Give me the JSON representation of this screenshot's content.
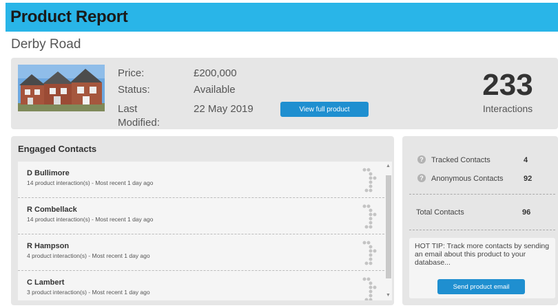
{
  "header": {
    "title": "Product Report"
  },
  "product": {
    "name": "Derby Road",
    "price_label": "Price:",
    "price": "£200,000",
    "status_label": "Status:",
    "status": "Available",
    "modified_label": "Last Modified:",
    "modified": "22 May 2019",
    "view_button": "View full product",
    "interactions": "233",
    "interactions_label": "Interactions"
  },
  "engaged": {
    "title": "Engaged Contacts",
    "contacts": [
      {
        "name": "D Bullimore",
        "meta": "14 product interaction(s) - Most recent 1 day ago"
      },
      {
        "name": "R Combellack",
        "meta": "14 product interaction(s) - Most recent 1 day ago"
      },
      {
        "name": "R Hampson",
        "meta": "4 product interaction(s) - Most recent 1 day ago"
      },
      {
        "name": "C Lambert",
        "meta": "3 product interaction(s) - Most recent 1 day ago"
      }
    ]
  },
  "stats": {
    "tracked_label": "Tracked Contacts",
    "tracked": "4",
    "anonymous_label": "Anonymous Contacts",
    "anonymous": "92",
    "total_label": "Total Contacts",
    "total": "96",
    "tip": "HOT TIP: Track more contacts by sending an email about this product to your database...",
    "send_button": "Send product email",
    "help_icon": "?"
  },
  "colors": {
    "accent": "#29b5e8",
    "button": "#1f8fd0",
    "panel": "#e6e6e6"
  }
}
